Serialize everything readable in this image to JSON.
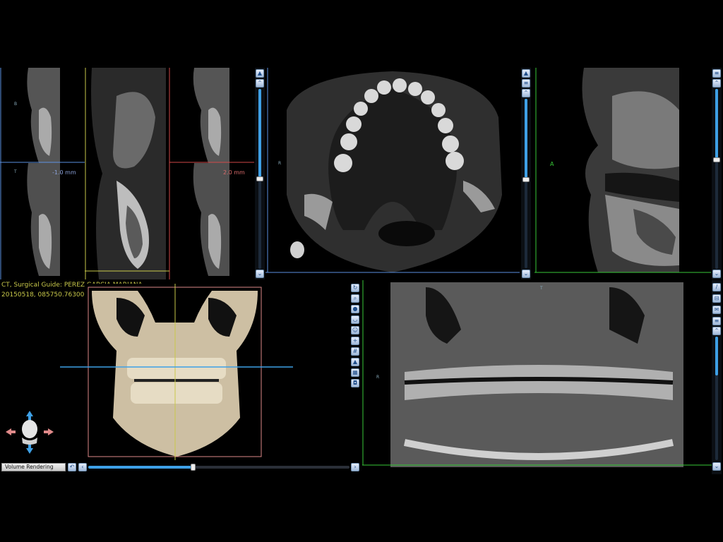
{
  "info": {
    "line1": "CT, Surgical Guide: PEREZ GARCIA MARIANA",
    "line2": "20150518, 085750.763000"
  },
  "cross_sections": {
    "offset_left": "-1.0 mm",
    "offset_right": "2.0 mm",
    "marker_b": "B",
    "marker_t": "T"
  },
  "axial": {
    "marker": "R"
  },
  "sagittal": {
    "marker": "A"
  },
  "panoramic": {
    "marker": "R",
    "top_marker": "T"
  },
  "volume": {
    "mode_label": "Volume Rendering"
  },
  "colors": {
    "accent_blue": "#3ea0e6",
    "label_yellow": "#c9c94a",
    "ruler_green": "#37c837",
    "ruler_blue": "#5a8fe0",
    "ruler_red": "#d04848"
  }
}
